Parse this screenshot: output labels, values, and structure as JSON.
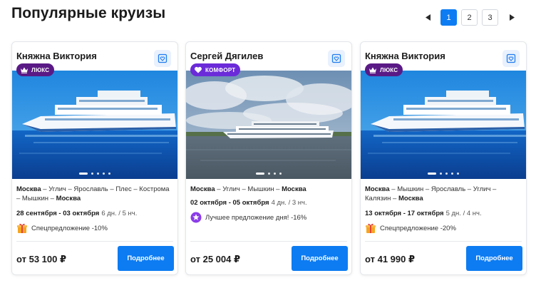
{
  "page": {
    "title": "Популярные круизы"
  },
  "pagination": {
    "pages": [
      "1",
      "2",
      "3"
    ],
    "active": "1"
  },
  "cards": [
    {
      "name": "Княжна Виктория",
      "badge": "ЛЮКС",
      "route_start": "Москва",
      "route_middle": " – Углич – Ярославль – Плес – Кострома – Мышкин – ",
      "route_end": "Москва",
      "date_from": "28 сентября",
      "date_sep": " - ",
      "date_to": "03 октября",
      "duration": "6 дн. / 5 нч.",
      "promo": "Спецпредложение -10%",
      "promo_icon": "gift-icon",
      "price": "от 53 100 ₽",
      "button": "Подробнее"
    },
    {
      "name": "Сергей Дягилев",
      "badge": "КОМФОРТ",
      "route_start": "Москва",
      "route_middle": " – Углич – Мышкин – ",
      "route_end": "Москва",
      "date_from": "02 октября",
      "date_sep": " - ",
      "date_to": "05 октября",
      "duration": "4 дн. / 3 нч.",
      "promo": "Лучшее предложение дня! -16%",
      "promo_icon": "star-icon",
      "price": "от 25 004 ₽",
      "button": "Подробнее"
    },
    {
      "name": "Княжна Виктория",
      "badge": "ЛЮКС",
      "route_start": "Москва",
      "route_middle": " – Мышкин – Ярославль – Углич – Калязин – ",
      "route_end": "Москва",
      "date_from": "13 октября",
      "date_sep": " - ",
      "date_to": "17 октября",
      "duration": "5 дн. / 4 нч.",
      "promo": "Спецпредложение -20%",
      "promo_icon": "gift-icon",
      "price": "от 41 990 ₽",
      "button": "Подробнее"
    }
  ],
  "colors": {
    "accent": "#0d7cf2",
    "badge_lux": "#5a1a86",
    "badge_comfort": "#6b2bd9"
  }
}
